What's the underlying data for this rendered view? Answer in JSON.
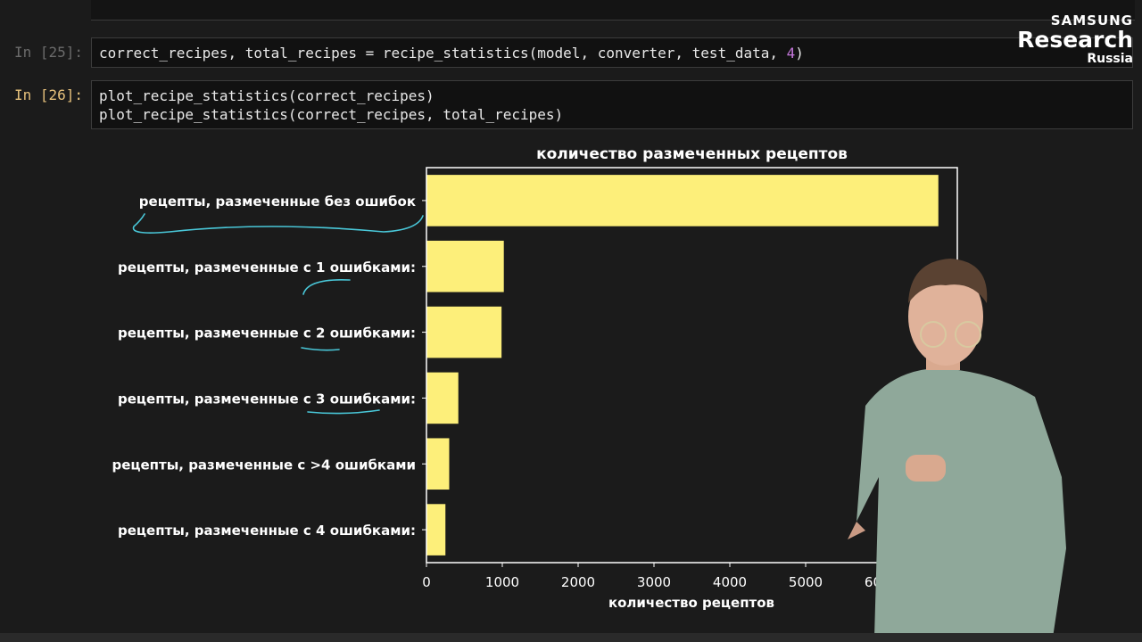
{
  "cells": [
    {
      "prompt": "In [25]:",
      "code_lines": [
        "correct_recipes, total_recipes = recipe_statistics(model, converter, test_data, 4)"
      ]
    },
    {
      "prompt": "In [26]:",
      "code_lines": [
        "plot_recipe_statistics(correct_recipes)",
        "plot_recipe_statistics(correct_recipes, total_recipes)"
      ]
    }
  ],
  "logo": {
    "line1": "SAMSUNG",
    "line2": "Research",
    "line3": "Russia"
  },
  "chart_data": {
    "type": "bar",
    "orientation": "horizontal",
    "title": "количество размеченных рецептов",
    "xlabel": "количество рецептов",
    "ylabel": "",
    "categories": [
      "рецепты, размеченные без ошибок",
      "рецепты, размеченные с 1 ошибками:",
      "рецепты, размеченные с 2 ошибками:",
      "рецепты, размеченные с 3 ошибками:",
      "рецепты, размеченные с >4 ошибками",
      "рецепты, размеченные с 4 ошибками:"
    ],
    "values": [
      6750,
      1020,
      990,
      420,
      300,
      250
    ],
    "xlim": [
      0,
      7000
    ],
    "xticks": [
      0,
      1000,
      2000,
      3000,
      4000,
      5000,
      6000
    ],
    "bar_color": "#fdef7a",
    "grid": false
  }
}
